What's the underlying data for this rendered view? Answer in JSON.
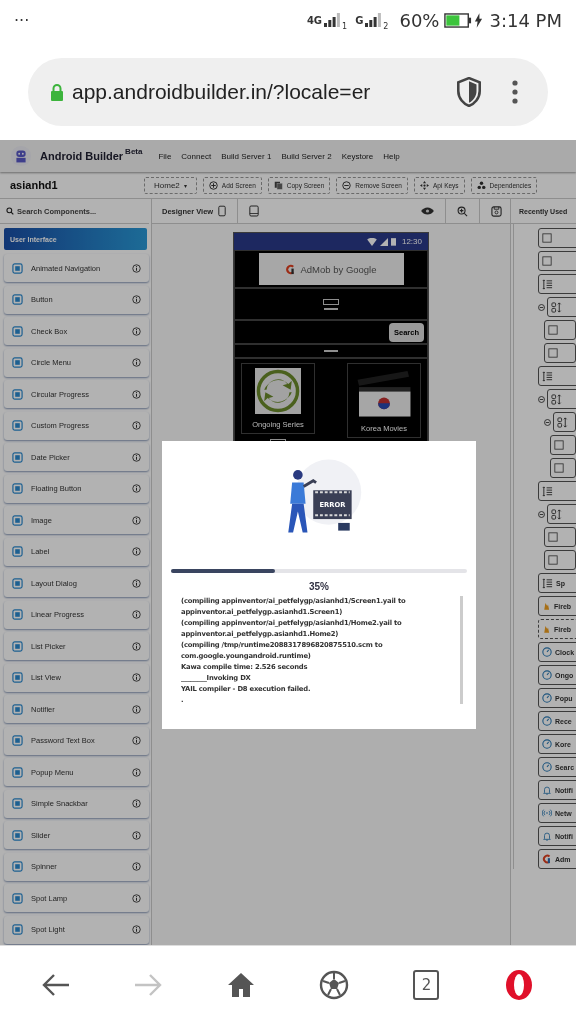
{
  "status_bar": {
    "dots": "...",
    "sims": [
      {
        "network": "4G",
        "slot": "1"
      },
      {
        "network": "G",
        "slot": "2"
      }
    ],
    "battery": "60%",
    "time": "3:14 PM"
  },
  "browser": {
    "url": "app.androidbuilder.in/?locale=er"
  },
  "app": {
    "name": "Android Builder",
    "badge": "Beta",
    "menu": [
      "File",
      "Connect",
      "Build Server 1",
      "Build Server 2",
      "Keystore",
      "Help"
    ]
  },
  "toolbar": {
    "project": "asianhd1",
    "screen": "Home2",
    "caret": "▾",
    "buttons": [
      {
        "kind": "add",
        "label": "Add Screen"
      },
      {
        "kind": "copy",
        "label": "Copy Screen"
      },
      {
        "kind": "remove",
        "label": "Remove Screen"
      },
      {
        "kind": "keys",
        "label": "Api Keys"
      },
      {
        "kind": "deps",
        "label": "Dependencies"
      }
    ]
  },
  "palette": {
    "search_placeholder": "Search Components...",
    "category": "User Interface",
    "items": [
      "Animated Navigation",
      "Button",
      "Check Box",
      "Circle Menu",
      "Circular Progress",
      "Custom Progress",
      "Date Picker",
      "Floating Button",
      "Image",
      "Label",
      "Layout Dialog",
      "Linear Progress",
      "List Picker",
      "List View",
      "Notifier",
      "Password Text Box",
      "Popup Menu",
      "Simple Snackbar",
      "Slider",
      "Spinner",
      "Spot Lamp",
      "Spot Light"
    ]
  },
  "designer": {
    "title": "Designer View",
    "phone": {
      "time": "12:30",
      "ad": "AdMob by Google",
      "search_button": "Search",
      "tiles": [
        {
          "kind": "refresh",
          "label": "Ongoing Series"
        },
        {
          "kind": "clapper",
          "label": "Korea Movies"
        }
      ]
    }
  },
  "components": {
    "title": "Recently Used",
    "tree": [
      {
        "kind": "box"
      },
      {
        "kind": "box"
      },
      {
        "kind": "vertical"
      },
      {
        "kind": "table",
        "expanded": true,
        "children": [
          {
            "kind": "box"
          },
          {
            "kind": "box"
          }
        ]
      },
      {
        "kind": "vertical"
      },
      {
        "kind": "table",
        "expanded": true,
        "children": [
          {
            "kind": "table",
            "expanded": true,
            "children": [
              {
                "kind": "box"
              },
              {
                "kind": "box"
              }
            ]
          }
        ]
      },
      {
        "kind": "vertical"
      },
      {
        "kind": "table",
        "expanded": true,
        "children": [
          {
            "kind": "box"
          },
          {
            "kind": "box"
          }
        ]
      },
      {
        "kind": "vertical",
        "label": "Sp"
      },
      {
        "kind": "firebase",
        "label": "Fireb",
        "visible": true
      },
      {
        "kind": "firebase",
        "label": "Fireb",
        "visible": false
      },
      {
        "kind": "clock",
        "label": "Clock"
      },
      {
        "kind": "clock",
        "label": "Ongo"
      },
      {
        "kind": "clock",
        "label": "Popu"
      },
      {
        "kind": "clock",
        "label": "Rece"
      },
      {
        "kind": "clock",
        "label": "Kore"
      },
      {
        "kind": "clock",
        "label": "Searc"
      },
      {
        "kind": "bell",
        "label": "Notifi"
      },
      {
        "kind": "wifi",
        "label": "Netw"
      },
      {
        "kind": "bell",
        "label": "Notifi"
      },
      {
        "kind": "admob",
        "label": "Adm"
      }
    ]
  },
  "build_dialog": {
    "illustration_text": "ERROR",
    "level": 0.35,
    "percent": "35%",
    "log": [
      "(compiling appinventor/ai_petfelygp/asianhd1/Screen1.yail to appinventor.ai_petfelygp.asianhd1.Screen1)",
      "(compiling appinventor/ai_petfelygp/asianhd1/Home2.yail to appinventor.ai_petfelygp.asianhd1.Home2)",
      "(compiling /tmp/runtime2088317896820875510.scm to com.google.youngandroid.runtime)",
      "Kawa compile time: 2.526 seconds",
      "________Invoking DX",
      "YAIL compiler - D8 execution failed.",
      "."
    ]
  },
  "nav": [
    {
      "kind": "back",
      "disabled": false
    },
    {
      "kind": "forward",
      "disabled": true
    },
    {
      "kind": "home",
      "disabled": false
    },
    {
      "kind": "ball",
      "disabled": false
    },
    {
      "kind": "tabs",
      "label": "2",
      "disabled": false
    },
    {
      "kind": "opera",
      "disabled": false
    }
  ]
}
